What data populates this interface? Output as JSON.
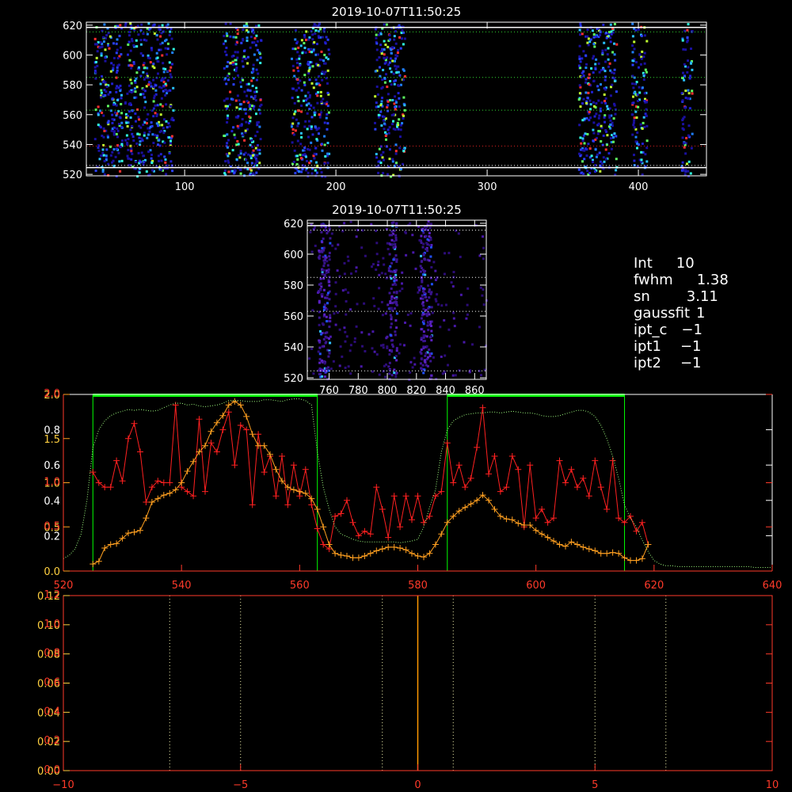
{
  "colors": {
    "background": "#000000",
    "axis_white": "#ffffff",
    "axis_red": "#ff3a2a",
    "axis_yellow": "#ffd040",
    "fit_line": "#ff2020",
    "orange_line": "#ffa020",
    "mask_green": "#00ff00",
    "guide_green": "#33dd33",
    "guide_red": "#dd2222",
    "guide_white": "#ffffff",
    "zero_line": "#ff9900"
  },
  "info_panel": [
    {
      "key": "Int",
      "value": "10"
    },
    {
      "key": "fwhm",
      "value": "1.38"
    },
    {
      "key": "sn",
      "value": "3.11"
    },
    {
      "key": "gaussfit",
      "value": "1"
    },
    {
      "key": "ipt_c",
      "value": "−1"
    },
    {
      "key": "ipt1",
      "value": "−1"
    },
    {
      "key": "ipt2",
      "value": "−1"
    }
  ],
  "chart_data": [
    {
      "id": "top-image",
      "type": "heatmap",
      "title": "2019-10-07T11:50:25",
      "xlim": [
        35,
        445
      ],
      "ylim": [
        519,
        622
      ],
      "xticks": [
        100,
        200,
        300,
        400
      ],
      "yticks": [
        520,
        540,
        560,
        580,
        600,
        620
      ],
      "signal_columns": [
        [
          40,
          58
        ],
        [
          60,
          92
        ],
        [
          125,
          150
        ],
        [
          170,
          195
        ],
        [
          225,
          245
        ],
        [
          360,
          385
        ],
        [
          395,
          405
        ],
        [
          428,
          435
        ]
      ],
      "horizontal_guides": [
        {
          "y": 524.5,
          "style": "solid",
          "color": "white"
        },
        {
          "y": 526,
          "style": "dotted",
          "color": "white"
        },
        {
          "y": 539,
          "style": "dotted",
          "color": "red"
        },
        {
          "y": 563,
          "style": "dotted",
          "color": "green"
        },
        {
          "y": 585,
          "style": "dotted",
          "color": "green"
        },
        {
          "y": 615.5,
          "style": "dotted",
          "color": "green"
        },
        {
          "y": 618.5,
          "style": "solid",
          "color": "white"
        }
      ]
    },
    {
      "id": "mid-image",
      "type": "heatmap",
      "title": "2019-10-07T11:50:25",
      "xlim": [
        745,
        868
      ],
      "ylim": [
        519,
        622
      ],
      "xticks": [
        760,
        780,
        800,
        820,
        840,
        860
      ],
      "yticks": [
        520,
        540,
        560,
        580,
        600,
        620
      ],
      "signal_columns": [
        [
          752,
          760
        ],
        [
          800,
          806
        ],
        [
          822,
          830
        ]
      ],
      "horizontal_guides": [
        {
          "y": 524.5,
          "style": "dotted",
          "color": "white"
        },
        {
          "y": 563,
          "style": "dotted",
          "color": "white"
        },
        {
          "y": 585,
          "style": "dotted",
          "color": "white"
        },
        {
          "y": 615.5,
          "style": "dotted",
          "color": "white"
        },
        {
          "y": 618.5,
          "style": "solid",
          "color": "white"
        }
      ]
    },
    {
      "id": "profile",
      "type": "line",
      "xlim": [
        520,
        640
      ],
      "xticks": [
        520,
        540,
        560,
        580,
        600,
        620,
        640
      ],
      "axis_sets": [
        {
          "color": "orange",
          "ylim": [
            0.0,
            2.0
          ],
          "ticks": [
            0.0,
            0.5,
            1.0,
            1.5,
            2.0
          ],
          "labels": [
            "0.0",
            "0.5",
            "1.0",
            "1.5",
            "2.0"
          ]
        },
        {
          "color": "red",
          "ylim": [
            0.0,
            2.0
          ],
          "ticks": [
            0.5,
            1.0,
            2.0
          ],
          "labels": [
            "0.5",
            "1.0",
            "2.0"
          ]
        },
        {
          "color": "white",
          "ylim": [
            0.0,
            1.0
          ],
          "ticks": [
            0.2,
            0.4,
            0.6,
            0.8
          ],
          "labels": [
            "0.2",
            "0.4",
            "0.6",
            "0.8"
          ]
        }
      ],
      "mask_regions": [
        [
          525,
          563
        ],
        [
          585,
          615
        ]
      ],
      "series": [
        {
          "style": "red-plus",
          "x": [
            525,
            526,
            527,
            528,
            529,
            530,
            531,
            532,
            533,
            534,
            535,
            536,
            537,
            538,
            539,
            540,
            541,
            542,
            543,
            544,
            545,
            546,
            547,
            548,
            549,
            550,
            551,
            552,
            553,
            554,
            555,
            556,
            557,
            558,
            559,
            560,
            561,
            562,
            563,
            564,
            565,
            566,
            567,
            568,
            569,
            570,
            571,
            572,
            573,
            574,
            575,
            576,
            577,
            578,
            579,
            580,
            581,
            582,
            583,
            584,
            585,
            586,
            587,
            588,
            589,
            590,
            591,
            592,
            593,
            594,
            595,
            596,
            597,
            598,
            599,
            600,
            601,
            602,
            603,
            604,
            605,
            606,
            607,
            608,
            609,
            610,
            611,
            612,
            613,
            614,
            615,
            616,
            617,
            618,
            619
          ],
          "y": [
            1.12,
            1.0,
            0.95,
            0.95,
            1.25,
            1.02,
            1.5,
            1.67,
            1.35,
            0.78,
            0.95,
            1.02,
            1.0,
            1.0,
            1.88,
            0.95,
            0.9,
            0.85,
            1.72,
            0.9,
            1.45,
            1.35,
            1.6,
            1.8,
            1.2,
            1.65,
            1.6,
            0.75,
            1.55,
            1.12,
            1.3,
            0.85,
            1.3,
            0.75,
            1.2,
            0.85,
            1.15,
            0.75,
            0.48,
            0.3,
            0.25,
            0.62,
            0.65,
            0.8,
            0.55,
            0.4,
            0.45,
            0.42,
            0.95,
            0.7,
            0.38,
            0.85,
            0.5,
            0.85,
            0.58,
            0.85,
            0.55,
            0.62,
            0.85,
            0.9,
            1.45,
            1.0,
            1.2,
            0.95,
            1.05,
            1.4,
            1.85,
            1.1,
            1.3,
            0.9,
            0.95,
            1.3,
            1.15,
            0.5,
            1.2,
            0.6,
            0.7,
            0.55,
            0.6,
            1.25,
            1.0,
            1.15,
            0.95,
            1.05,
            0.85,
            1.25,
            0.95,
            0.7,
            1.25,
            0.6,
            0.55,
            0.62,
            0.45,
            0.55,
            0.3
          ]
        },
        {
          "style": "orange-plus",
          "x": [
            525,
            526,
            527,
            528,
            529,
            530,
            531,
            532,
            533,
            534,
            535,
            536,
            537,
            538,
            539,
            540,
            541,
            542,
            543,
            544,
            545,
            546,
            547,
            548,
            549,
            550,
            551,
            552,
            553,
            554,
            555,
            556,
            557,
            558,
            559,
            560,
            561,
            562,
            563,
            564,
            565,
            566,
            567,
            568,
            569,
            570,
            571,
            572,
            573,
            574,
            575,
            576,
            577,
            578,
            579,
            580,
            581,
            582,
            583,
            584,
            585,
            586,
            587,
            588,
            589,
            590,
            591,
            592,
            593,
            594,
            595,
            596,
            597,
            598,
            599,
            600,
            601,
            602,
            603,
            604,
            605,
            606,
            607,
            608,
            609,
            610,
            611,
            612,
            613,
            614,
            615,
            616,
            617,
            618,
            619
          ],
          "y": [
            0.08,
            0.11,
            0.26,
            0.3,
            0.31,
            0.37,
            0.43,
            0.44,
            0.46,
            0.6,
            0.78,
            0.82,
            0.86,
            0.88,
            0.92,
            1.0,
            1.13,
            1.24,
            1.35,
            1.42,
            1.58,
            1.68,
            1.76,
            1.88,
            1.92,
            1.88,
            1.75,
            1.55,
            1.42,
            1.42,
            1.32,
            1.15,
            1.02,
            0.95,
            0.92,
            0.9,
            0.88,
            0.82,
            0.7,
            0.5,
            0.3,
            0.2,
            0.18,
            0.17,
            0.15,
            0.15,
            0.17,
            0.2,
            0.23,
            0.25,
            0.27,
            0.27,
            0.26,
            0.24,
            0.2,
            0.17,
            0.16,
            0.2,
            0.3,
            0.42,
            0.55,
            0.62,
            0.68,
            0.72,
            0.76,
            0.8,
            0.86,
            0.8,
            0.7,
            0.62,
            0.59,
            0.58,
            0.54,
            0.52,
            0.52,
            0.46,
            0.42,
            0.38,
            0.34,
            0.3,
            0.28,
            0.33,
            0.3,
            0.27,
            0.25,
            0.23,
            0.2,
            0.2,
            0.21,
            0.2,
            0.15,
            0.12,
            0.12,
            0.14,
            0.3
          ]
        },
        {
          "style": "green-dotted",
          "x": [
            520,
            521,
            522,
            523,
            524,
            525,
            526,
            527,
            528,
            529,
            530,
            531,
            532,
            533,
            534,
            535,
            536,
            537,
            538,
            539,
            540,
            541,
            542,
            543,
            544,
            545,
            546,
            547,
            548,
            549,
            550,
            551,
            552,
            553,
            554,
            555,
            556,
            557,
            558,
            559,
            560,
            561,
            562,
            563,
            564,
            565,
            566,
            567,
            568,
            569,
            570,
            571,
            572,
            573,
            574,
            575,
            576,
            577,
            578,
            579,
            580,
            581,
            582,
            583,
            584,
            585,
            586,
            587,
            588,
            589,
            590,
            591,
            592,
            593,
            594,
            595,
            596,
            597,
            598,
            599,
            600,
            601,
            602,
            603,
            604,
            605,
            606,
            607,
            608,
            609,
            610,
            611,
            612,
            613,
            614,
            615,
            616,
            617,
            618,
            619,
            620,
            621,
            622,
            623,
            624,
            625,
            626,
            627,
            628,
            629,
            630,
            631,
            632,
            633,
            634,
            635,
            636,
            637,
            638,
            639,
            640
          ],
          "y": [
            0.14,
            0.18,
            0.25,
            0.42,
            0.8,
            1.4,
            1.6,
            1.7,
            1.76,
            1.79,
            1.81,
            1.83,
            1.82,
            1.83,
            1.82,
            1.81,
            1.82,
            1.85,
            1.88,
            1.9,
            1.9,
            1.88,
            1.89,
            1.87,
            1.86,
            1.87,
            1.88,
            1.9,
            1.93,
            1.93,
            1.93,
            1.92,
            1.92,
            1.92,
            1.94,
            1.94,
            1.93,
            1.92,
            1.94,
            1.95,
            1.95,
            1.93,
            1.88,
            1.35,
            0.95,
            0.7,
            0.5,
            0.42,
            0.39,
            0.36,
            0.34,
            0.33,
            0.33,
            0.33,
            0.33,
            0.33,
            0.33,
            0.32,
            0.33,
            0.34,
            0.36,
            0.5,
            0.72,
            0.92,
            1.35,
            1.6,
            1.7,
            1.74,
            1.77,
            1.78,
            1.79,
            1.79,
            1.8,
            1.8,
            1.79,
            1.8,
            1.81,
            1.8,
            1.79,
            1.79,
            1.78,
            1.76,
            1.75,
            1.75,
            1.76,
            1.78,
            1.8,
            1.82,
            1.82,
            1.8,
            1.75,
            1.65,
            1.5,
            1.3,
            1.05,
            0.75,
            0.6,
            0.5,
            0.35,
            0.22,
            0.12,
            0.08,
            0.06,
            0.06,
            0.05,
            0.05,
            0.05,
            0.05,
            0.05,
            0.05,
            0.05,
            0.05,
            0.05,
            0.05,
            0.05,
            0.05,
            0.05,
            0.04,
            0.04,
            0.04,
            0.04
          ]
        }
      ]
    },
    {
      "id": "bottom-plot",
      "type": "line",
      "xlim": [
        -10,
        10
      ],
      "xticks": [
        -10,
        -5,
        0,
        5,
        10
      ],
      "axis_sets": [
        {
          "color": "yellow",
          "ylim": [
            0.0,
            0.12
          ],
          "ticks": [
            0.0,
            0.02,
            0.04,
            0.06,
            0.08,
            0.1,
            0.12
          ],
          "labels": [
            "0.00",
            "0.02",
            "0.04",
            "0.06",
            "0.08",
            "0.10",
            "0.12"
          ]
        },
        {
          "color": "red",
          "ylim": [
            0.0,
            1.2
          ],
          "ticks": [
            0.0,
            0.2,
            0.4,
            0.6,
            0.8,
            1.0,
            1.2
          ],
          "labels": [
            "0.0",
            "0.2",
            "0.4",
            "0.6",
            "0.8",
            "1.0",
            "1.2"
          ]
        }
      ],
      "vertical_guides": [
        -7,
        -5,
        -1,
        1,
        5,
        7
      ],
      "zero_line": 0
    }
  ]
}
